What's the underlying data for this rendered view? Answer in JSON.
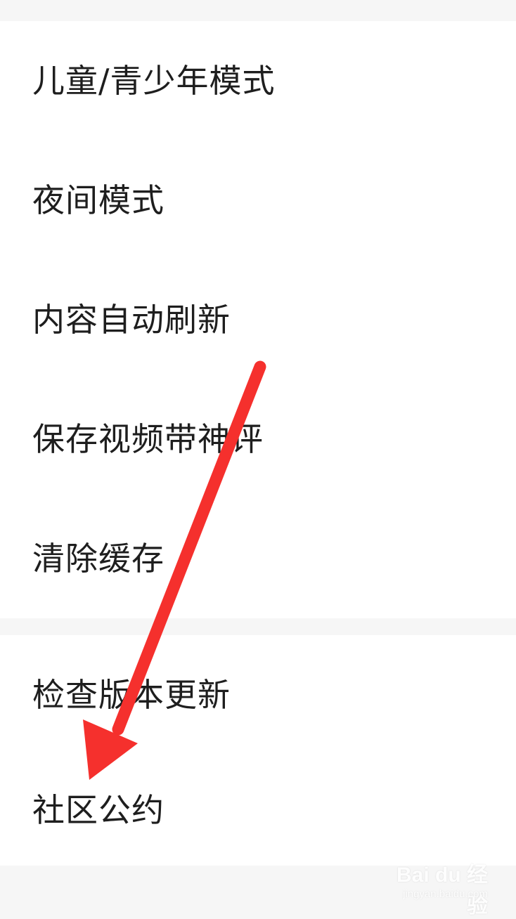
{
  "settings": {
    "group1": [
      {
        "label": "儿童/青少年模式"
      },
      {
        "label": "夜间模式"
      },
      {
        "label": "内容自动刷新"
      },
      {
        "label": "保存视频带神评"
      },
      {
        "label": "清除缓存"
      }
    ],
    "group2": [
      {
        "label": "检查版本更新"
      },
      {
        "label": "社区公约"
      }
    ]
  },
  "annotation": {
    "arrow_color": "#f5302d",
    "points_to": "社区公约"
  },
  "watermark": {
    "main": "Bai du 经验",
    "sub": "jingyan.baidu.com"
  },
  "colors": {
    "background": "#f6f6f6",
    "card": "#ffffff",
    "text": "#1e1e1e"
  }
}
